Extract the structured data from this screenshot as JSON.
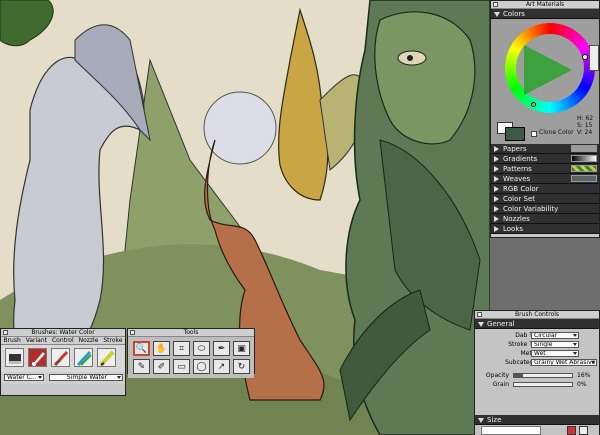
{
  "art_materials": {
    "title": "Art Materials",
    "colors_label": "Colors",
    "clone_color_label": "Clone Color",
    "hsv": {
      "h": "H: 62",
      "s": "S: 15",
      "v": "V: 24"
    },
    "current_color": "#3f5a44",
    "sections": [
      {
        "label": "Papers",
        "swatch": "#9a9a9a"
      },
      {
        "label": "Gradients",
        "swatch": "#1b1b1b"
      },
      {
        "label": "Patterns",
        "swatch": "#2e8f3a"
      },
      {
        "label": "Weaves",
        "swatch": "#7c5d2a"
      },
      {
        "label": "RGB Color",
        "swatch": ""
      },
      {
        "label": "Color Set",
        "swatch": ""
      },
      {
        "label": "Color Variability",
        "swatch": ""
      },
      {
        "label": "Nozzles",
        "swatch": ""
      },
      {
        "label": "Looks",
        "swatch": ""
      }
    ]
  },
  "brush_controls": {
    "title": "Brush Controls",
    "general_label": "General",
    "dab_type": {
      "label": "Dab Type",
      "value": "Circular"
    },
    "stroke_type": {
      "label": "Stroke Type",
      "value": "Single"
    },
    "method": {
      "label": "Method",
      "value": "Wet"
    },
    "subcategory": {
      "label": "Subcategory",
      "value": "Grainy Wet Abrasive"
    },
    "opacity": {
      "label": "Opacity",
      "value": "16%",
      "level": 0.16
    },
    "grain": {
      "label": "Grain",
      "value": "0%",
      "level": 0.0
    },
    "size_label": "Size"
  },
  "brushes": {
    "title": "Brushes: Water Color",
    "tabs": [
      "Brush",
      "Variant",
      "Control",
      "Nozzle",
      "Stroke"
    ],
    "category": "Water C...",
    "variant": "Simple Water"
  },
  "tools": {
    "title": "Tools",
    "icons": [
      "magnifier-icon",
      "grabber-icon",
      "crop-icon",
      "lasso-icon",
      "pen-icon",
      "paint-bucket-icon",
      "brush-icon",
      "dropper-icon",
      "rect-select-icon",
      "oval-select-icon",
      "text-icon",
      "rotate-icon"
    ]
  }
}
